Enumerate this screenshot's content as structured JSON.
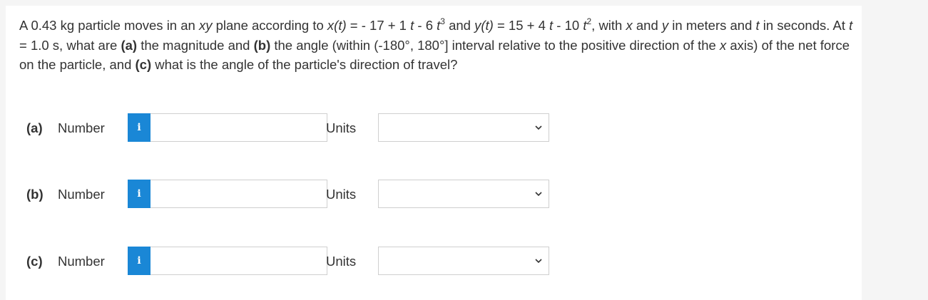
{
  "question": {
    "t1": "A 0.43 kg particle moves in an ",
    "t2": "xy",
    "t3": " plane according to ",
    "t4": "x(t)",
    "t5": " = - 17 + 1 ",
    "t6": "t",
    "t7": " - 6 ",
    "t8": "t",
    "t9": "3",
    "t10": " and ",
    "t11": "y(t)",
    "t12": " = 15 + 4 ",
    "t13": "t",
    "t14": " - 10 ",
    "t15": "t",
    "t16": "2",
    "t17": ", with ",
    "t18": "x",
    "t19": " and ",
    "t20": "y",
    "t21": " in meters and ",
    "t22": "t",
    "t23": " in seconds. At ",
    "t24": "t",
    "t25": " = 1.0 s, what are ",
    "t26": "(a)",
    "t27": " the magnitude and ",
    "t28": "(b)",
    "t29": " the angle (within (-180°, 180°] interval relative to the positive direction of the ",
    "t30": "x",
    "t31": " axis) of the net force on the particle, and ",
    "t32": "(c)",
    "t33": " what is the angle of the particle's direction of travel?"
  },
  "parts": [
    {
      "label": "(a)",
      "number_label": "Number",
      "info_glyph": "i",
      "value": "",
      "units_label": "Units",
      "units_selected": ""
    },
    {
      "label": "(b)",
      "number_label": "Number",
      "info_glyph": "i",
      "value": "",
      "units_label": "Units",
      "units_selected": ""
    },
    {
      "label": "(c)",
      "number_label": "Number",
      "info_glyph": "i",
      "value": "",
      "units_label": "Units",
      "units_selected": ""
    }
  ],
  "colors": {
    "info_button": "#1a87d6",
    "text": "#333333",
    "border": "#cfcfcf"
  },
  "icons": {
    "info": "info-icon",
    "dropdown": "chevron-down-icon"
  }
}
